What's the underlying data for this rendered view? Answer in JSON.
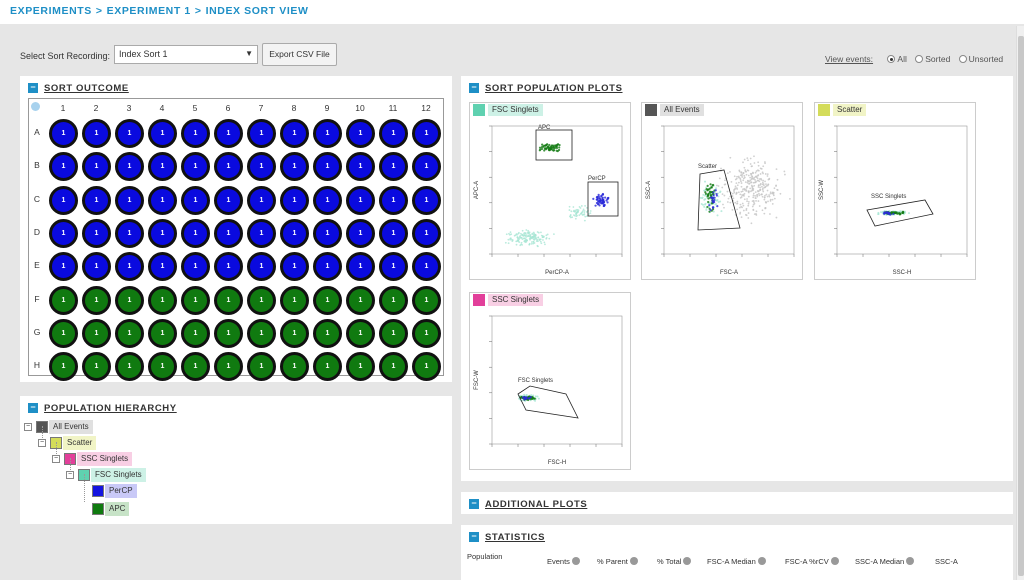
{
  "breadcrumb": {
    "items": [
      "EXPERIMENTS",
      "EXPERIMENT 1",
      "INDEX SORT VIEW"
    ],
    "separator": ">"
  },
  "toolbar": {
    "select_label": "Select Sort Recording:",
    "select_value": "Index Sort 1",
    "export_button": "Export CSV File",
    "view_events_label": "View events:",
    "view_options": [
      "All",
      "Sorted",
      "Unsorted"
    ],
    "view_selected": "All"
  },
  "sort_outcome": {
    "title": "SORT OUTCOME",
    "columns": [
      "1",
      "2",
      "3",
      "4",
      "5",
      "6",
      "7",
      "8",
      "9",
      "10",
      "11",
      "12"
    ],
    "rows": [
      "A",
      "B",
      "C",
      "D",
      "E",
      "F",
      "G",
      "H"
    ],
    "well_value": "1",
    "row_colors": {
      "A": "blue",
      "B": "blue",
      "C": "blue",
      "D": "blue",
      "E": "blue",
      "F": "green",
      "G": "green",
      "H": "green"
    }
  },
  "hierarchy": {
    "title": "POPULATION HIERARCHY",
    "nodes": [
      {
        "label": "All Events",
        "color": "#555555",
        "bg": "#e0e0e0"
      },
      {
        "label": "Scatter",
        "color": "#d4dc5a",
        "bg": "#f1f4c6"
      },
      {
        "label": "SSC Singlets",
        "color": "#e23f9a",
        "bg": "#f8cfe4"
      },
      {
        "label": "FSC Singlets",
        "color": "#5fd1b0",
        "bg": "#cdf1e6"
      },
      {
        "label": "PerCP",
        "color": "#1414e0",
        "bg": "#c9c9f7"
      },
      {
        "label": "APC",
        "color": "#0f7a0f",
        "bg": "#c7e3c7"
      }
    ]
  },
  "plots": {
    "title": "SORT POPULATION PLOTS",
    "items": [
      {
        "name": "FSC Singlets",
        "swatch": "#5fd1b0",
        "bg": "#cdf1e6",
        "xlabel": "PerCP-A",
        "ylabel": "APC-A",
        "gates": [
          "APC",
          "PerCP"
        ]
      },
      {
        "name": "All Events",
        "swatch": "#555555",
        "bg": "#e0e0e0",
        "xlabel": "FSC-A",
        "ylabel": "SSC-A",
        "gates": [
          "Scatter"
        ]
      },
      {
        "name": "Scatter",
        "swatch": "#d4dc5a",
        "bg": "#f1f4c6",
        "xlabel": "SSC-H",
        "ylabel": "SSC-W",
        "gates": [
          "SSC Singlets"
        ]
      },
      {
        "name": "SSC Singlets",
        "swatch": "#e23f9a",
        "bg": "#f8cfe4",
        "xlabel": "FSC-H",
        "ylabel": "FSC-W",
        "gates": [
          "FSC Singlets"
        ]
      }
    ]
  },
  "additional": {
    "title": "ADDITIONAL PLOTS"
  },
  "statistics": {
    "title": "STATISTICS",
    "columns": [
      "Population",
      "Events",
      "% Parent",
      "% Total",
      "FSC-A Median",
      "FSC-A %rCV",
      "SSC-A Median",
      "SSC-A"
    ]
  },
  "colors": {
    "accent": "#1e8fc6",
    "blue_well": "#0a0adf",
    "green_well": "#107a10"
  }
}
